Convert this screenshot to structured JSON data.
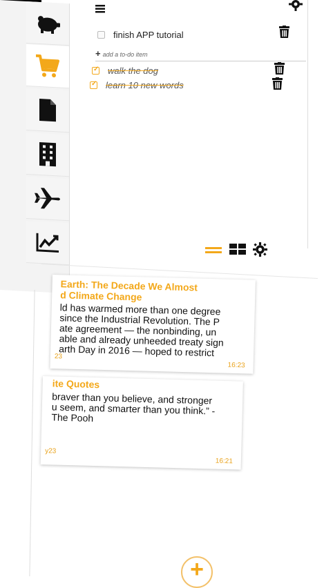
{
  "todo": {
    "items": [
      {
        "text": "finish APP tutorial",
        "done": false
      },
      {
        "text": "walk the dog",
        "done": true
      },
      {
        "text": "learn 10 new words",
        "done": true
      }
    ],
    "add_placeholder": "add a to-do item"
  },
  "notes": [
    {
      "title_line1": "Earth: The Decade We Almost",
      "title_line2": "d Climate Change",
      "body": [
        "ld has warmed more than one degree",
        "since the Industrial Revolution. The P",
        "ate agreement — the nonbinding, un",
        "able and already unheeded treaty sign",
        "arth Day in 2016 — hoped to restrict"
      ],
      "time_left": "23",
      "time_right": "16:23"
    },
    {
      "title_line1": "ite Quotes",
      "title_line2": "",
      "body": [
        "braver than you believe, and stronger",
        "u seem, and smarter than you think.” -",
        "The Pooh"
      ],
      "time_left": "y23",
      "time_right": "16:21"
    }
  ],
  "colors": {
    "accent": "#f3a81a",
    "sidebar_bg": "#f3f3f3"
  },
  "icons": [
    "piggy-bank-icon",
    "cart-icon",
    "file-icon",
    "building-icon",
    "airplane-icon",
    "chart-icon",
    "menu-icon",
    "gear-icon",
    "trash-icon",
    "list-view-icon",
    "grid-view-icon",
    "plus-icon"
  ]
}
